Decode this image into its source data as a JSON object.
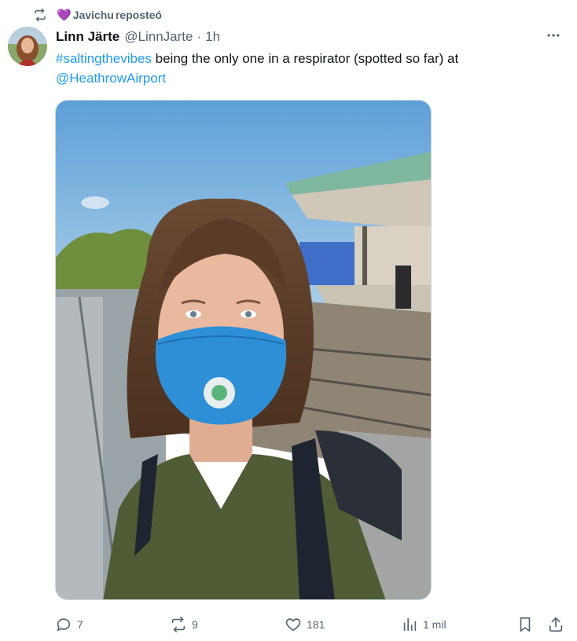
{
  "repost": {
    "user": "Javichu",
    "label": "reposteó",
    "heart_emoji": "💜"
  },
  "tweet": {
    "author_name": "Linn Järte",
    "author_handle": "@LinnJarte",
    "separator": "·",
    "timestamp": "1h",
    "hashtag": "#saltingthevibes",
    "text_middle": " being the only one in a respirator (spotted so far) at ",
    "mention": "@HeathrowAirport"
  },
  "actions": {
    "replies": "7",
    "reposts": "9",
    "likes": "181",
    "views": "1 mil"
  },
  "icons": {
    "repost": "repost-icon",
    "more": "more-icon",
    "reply": "reply-icon",
    "like": "heart-icon",
    "views": "views-icon",
    "bookmark": "bookmark-icon",
    "share": "share-icon"
  },
  "colors": {
    "link": "#1d9bf0",
    "secondary_text": "#536471",
    "primary_text": "#0f1419",
    "mask_blue": "#2e8fd6"
  }
}
